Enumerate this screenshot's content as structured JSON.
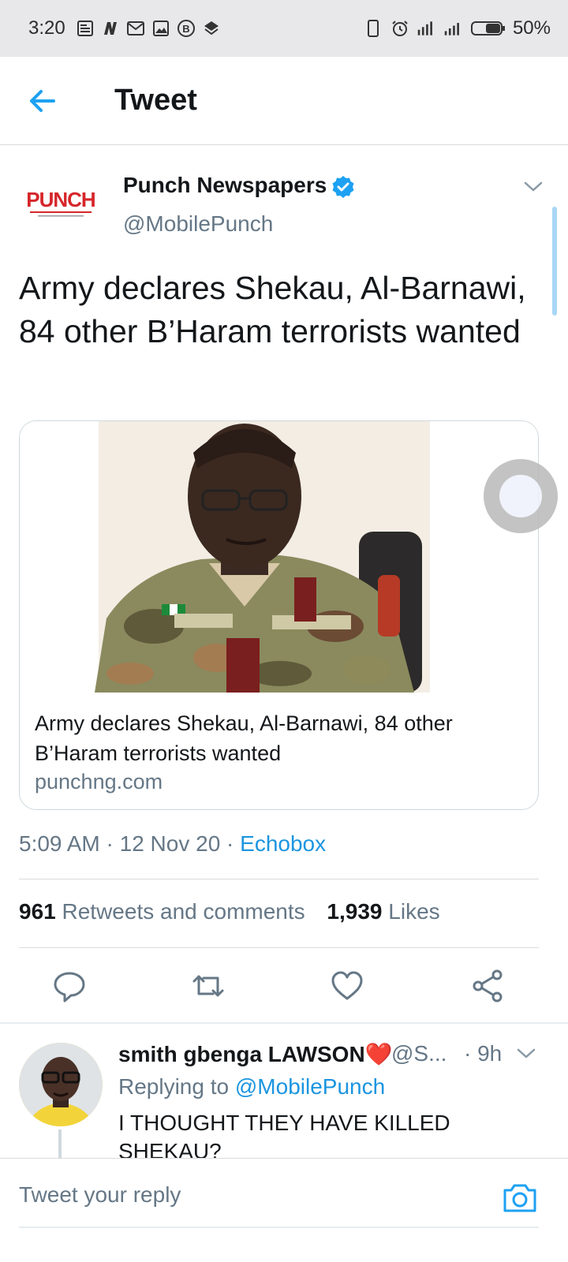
{
  "status_bar": {
    "time": "3:20",
    "battery": "50%",
    "left_icons": [
      "news-icon",
      "n-app-icon",
      "mail-icon",
      "gallery-icon",
      "b-app-icon",
      "layers-icon"
    ],
    "right_icons": [
      "vibrate-icon",
      "alarm-icon",
      "signal-data-icon",
      "signal-bars-icon",
      "battery-icon"
    ]
  },
  "header": {
    "title": "Tweet",
    "accent_color": "#1DA1F2"
  },
  "tweet": {
    "author": "Punch Newspapers",
    "handle": "@MobilePunch",
    "verified": true,
    "avatar_logo": "PUNCH",
    "text": "Army declares Shekau, Al-Barnawi, 84 other B’Haram terrorists wanted",
    "card": {
      "title": "Army declares Shekau, Al-Barnawi, 84 other B’Haram terrorists wanted",
      "domain": "punchng.com"
    },
    "time": "5:09 AM",
    "date": "12 Nov 20",
    "separator": "·",
    "source": "Echobox",
    "retweets_count": "961",
    "retweets_label": "Retweets and comments",
    "likes_count": "1,939",
    "likes_label": "Likes",
    "actions": [
      "reply-icon",
      "retweet-icon",
      "like-icon",
      "share-icon"
    ]
  },
  "reply": {
    "name": "smith gbenga LAWSON",
    "name_emoji": "❤️",
    "handle": "@S...",
    "time": "· 9h",
    "replying_prefix": "Replying to",
    "replying_to": "@MobilePunch",
    "text": "I THOUGHT THEY HAVE KILLED SHEKAU?"
  },
  "composer": {
    "placeholder": "Tweet your reply"
  }
}
